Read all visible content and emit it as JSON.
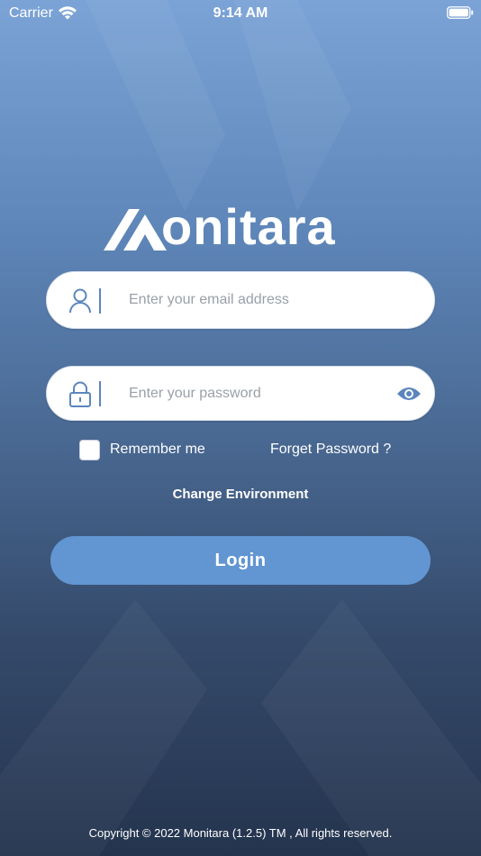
{
  "status_bar": {
    "carrier": "Carrier",
    "time": "9:14 AM"
  },
  "logo": {
    "text": "onitara"
  },
  "email_field": {
    "placeholder": "Enter your email address",
    "value": ""
  },
  "password_field": {
    "placeholder": "Enter your password",
    "value": ""
  },
  "remember": {
    "label": "Remember me",
    "checked": false
  },
  "forget_password": {
    "label": "Forget Password ?"
  },
  "change_environment": {
    "label": "Change Environment"
  },
  "login_button": {
    "label": "Login"
  },
  "footer": {
    "copyright": "Copyright © 2022 Monitara (1.2.5) TM , All rights reserved."
  },
  "colors": {
    "accent": "#6196d2",
    "icon_blue": "#5b86bd"
  }
}
